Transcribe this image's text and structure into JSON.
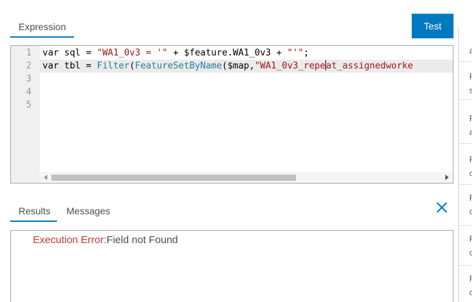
{
  "top_tabs": {
    "expression": "Expression"
  },
  "test_button": "Test",
  "editor": {
    "line_numbers": [
      "1",
      "2",
      "3",
      "4",
      "5"
    ],
    "line1": {
      "kw": "var",
      "ident": " sql = ",
      "str1": "\"WA1_0v3 = '\"",
      "mid": " + $feature.WA1_0v3 + ",
      "str2": "\"'\"",
      "end": ";"
    },
    "line2": {
      "kw": "var",
      "ident": " tbl = ",
      "fn1": "Filter",
      "p1": "(",
      "fn2": "FeatureSetByName",
      "args": "($map,",
      "str_a": "\"WA1_0v3_repe",
      "str_b": "at_assignedworke"
    }
  },
  "bottom_tabs": {
    "results": "Results",
    "messages": "Messages"
  },
  "results": {
    "error_label": "Execution Error:",
    "error_message": "Field not Found"
  },
  "right_panel": {
    "letters": [
      "a",
      "F",
      "s",
      "F",
      "a",
      "F",
      "c",
      "F",
      "c",
      "F",
      "c",
      "F",
      "c"
    ]
  },
  "colors": {
    "accent": "#0079c1",
    "error": "#c13838",
    "string": "#a31515",
    "function": "#267f99"
  }
}
